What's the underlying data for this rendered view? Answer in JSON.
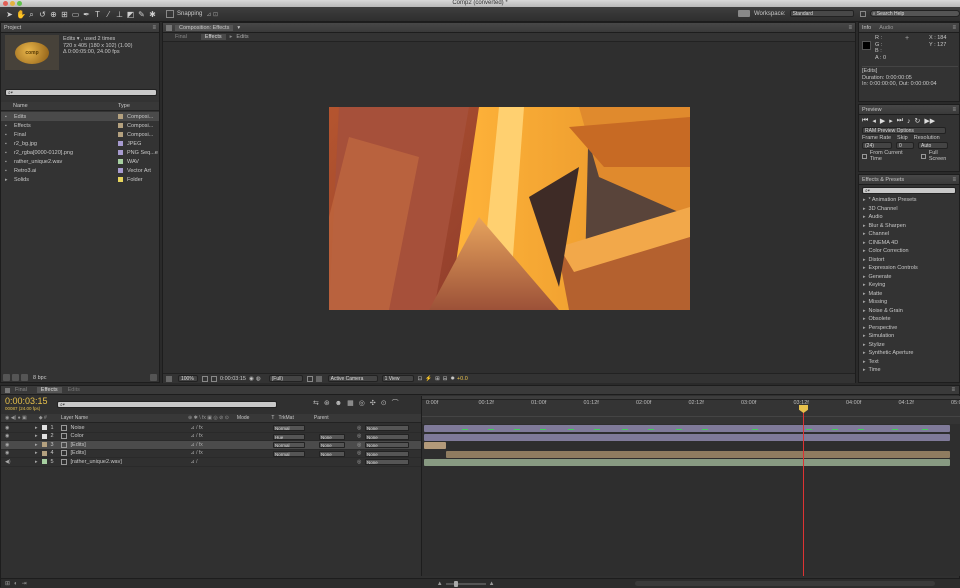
{
  "window": {
    "title": "Comp2 (converted) *"
  },
  "toolbar": {
    "snapping_label": "Snapping",
    "workspace_label": "Workspace:",
    "workspace_value": "Standard",
    "search_placeholder": "Search Help"
  },
  "project": {
    "tab_label": "Project",
    "thumb_text": "comp",
    "info_line1": "Edits ▾ , used 2 times",
    "info_line2": "720 x 405  (180 x 102) (1.00)",
    "info_line3": "Δ 0:00:05:00, 24.00 fps",
    "search_placeholder": "⌕▾",
    "col_name": "Name",
    "col_type": "Type",
    "items": [
      {
        "name": "Edits",
        "type": "Composi...",
        "color": "#b4a17f",
        "icon": "composition-icon"
      },
      {
        "name": "Effects",
        "type": "Composi...",
        "color": "#b4a17f",
        "icon": "composition-icon"
      },
      {
        "name": "Final",
        "type": "Composi...",
        "color": "#b4a17f",
        "icon": "composition-icon"
      },
      {
        "name": "r2_bg.jpg",
        "type": "JPEG",
        "color": "#a79bd0",
        "icon": "image-icon"
      },
      {
        "name": "r2_rgba[0000-0120].png",
        "type": "PNG Seq...e",
        "color": "#a79bd0",
        "icon": "image-sequence-icon"
      },
      {
        "name": "rather_unique2.wav",
        "type": "WAV",
        "color": "#a6cfa0",
        "icon": "audio-icon"
      },
      {
        "name": "Retro3.ai",
        "type": "Vector Art",
        "color": "#a79bd0",
        "icon": "vector-icon"
      },
      {
        "name": "Solids",
        "type": "Folder",
        "color": "#e8d65e",
        "icon": "folder-icon"
      }
    ],
    "bpc_label": "8 bpc"
  },
  "composition": {
    "tab_label": "Composition: Effects",
    "breadcrumbs": [
      "Final",
      "Effects",
      "Edits"
    ],
    "zoom": "100%",
    "timecode": "0:00:03:15",
    "resolution": "(Full)",
    "camera": "Active Camera",
    "view": "1 View",
    "exposure": "+0.0"
  },
  "info": {
    "tab_info": "Info",
    "tab_audio": "Audio",
    "r": "R :",
    "g": "G :",
    "b": "B :",
    "a": "A : 0",
    "x": "X : 184",
    "y": "Y : 127",
    "layer_name": "[Edits]",
    "duration": "Duration: 0:00:00:05",
    "in_out": "In: 0:00:00:00, Out: 0:00:00:04"
  },
  "preview": {
    "tab_label": "Preview",
    "ram_options": "RAM Preview Options",
    "frame_rate_label": "Frame Rate",
    "skip_label": "Skip",
    "resolution_label": "Resolution",
    "frame_rate_value": "(24)",
    "skip_value": "0",
    "resolution_value": "Auto",
    "from_current": "From Current Time",
    "full_screen": "Full Screen"
  },
  "effects_presets": {
    "tab_label": "Effects & Presets",
    "search_placeholder": "⌕▾",
    "items": [
      "* Animation Presets",
      "3D Channel",
      "Audio",
      "Blur & Sharpen",
      "Channel",
      "CINEMA 4D",
      "Color Correction",
      "Distort",
      "Expression Controls",
      "Generate",
      "Keying",
      "Matte",
      "Missing",
      "Noise & Grain",
      "Obsolete",
      "Perspective",
      "Simulation",
      "Stylize",
      "Synthetic Aperture",
      "Text",
      "Time"
    ]
  },
  "timeline": {
    "tabs": [
      "Final",
      "Effects",
      "Edits"
    ],
    "timecode": "0:00:03:15",
    "frame_info": "00087 (24.00 fps)",
    "search_placeholder": "⌕▾",
    "col_layer_name": "Layer Name",
    "col_mode": "Mode",
    "col_t": "T",
    "col_trkmat": "TrkMat",
    "col_parent": "Parent",
    "ruler": [
      "0:00f",
      "00:12f",
      "01:00f",
      "01:12f",
      "02:00f",
      "02:12f",
      "03:00f",
      "03:12f",
      "04:00f",
      "04:12f",
      "05:0"
    ],
    "layers": [
      {
        "num": "1",
        "name": "Noise",
        "color": "#e0e0e0",
        "mode": "Normal",
        "trkmat": "",
        "parent": "None",
        "bar": "#7f7a99"
      },
      {
        "num": "2",
        "name": "Color",
        "color": "#e0e0e0",
        "mode": "Hue",
        "trkmat": "None",
        "parent": "None",
        "bar": "#7f7a99"
      },
      {
        "num": "3",
        "name": "[Edits]",
        "color": "#b4a17f",
        "mode": "Normal",
        "trkmat": "None",
        "parent": "None",
        "bar": "#b39a7a"
      },
      {
        "num": "4",
        "name": "[Edits]",
        "color": "#b4a17f",
        "mode": "Normal",
        "trkmat": "None",
        "parent": "None",
        "bar": "#8f7c60"
      },
      {
        "num": "5",
        "name": "[rather_unique2.wav]",
        "color": "#a6cfa0",
        "mode": "",
        "trkmat": "",
        "parent": "None",
        "bar": "#889a82"
      }
    ]
  }
}
